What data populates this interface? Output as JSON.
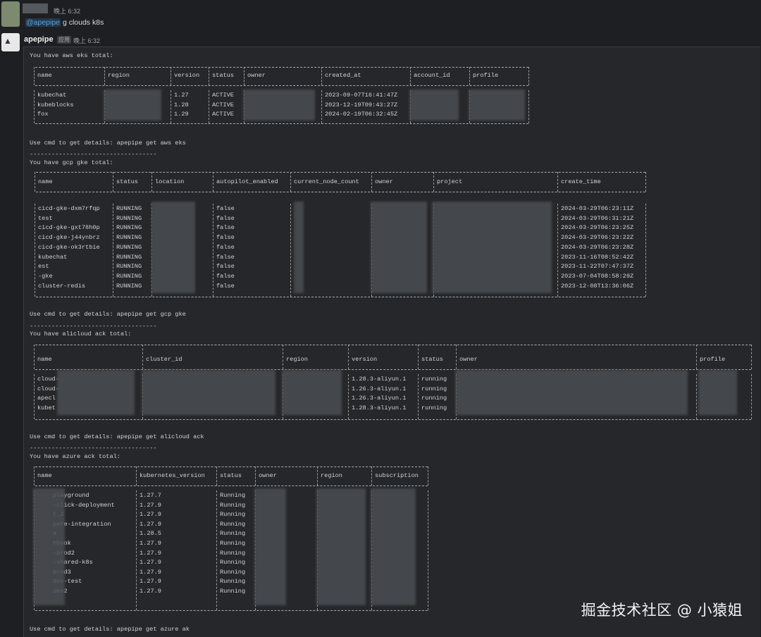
{
  "message1": {
    "time": "晚上 6:32",
    "mention": "@apepipe",
    "text": " g clouds k8s"
  },
  "message2": {
    "sender": "apepipe",
    "badge": "应用",
    "time": "晚上 6:32"
  },
  "eks": {
    "intro": "You have aws eks total:",
    "headers": [
      "name",
      "region",
      "version",
      "status",
      "owner",
      "created_at",
      "account_id",
      "profile"
    ],
    "rows": [
      [
        "kubechat",
        "",
        "1.27",
        "ACTIVE",
        "",
        "2023-09-07T16:41:47Z",
        "",
        ""
      ],
      [
        "kubeblocks",
        "",
        "1.28",
        "ACTIVE",
        "",
        "2023-12-19T09:43:27Z",
        "",
        ""
      ],
      [
        "fox",
        "",
        "1.29",
        "ACTIVE",
        "",
        "2024-02-19T06:32:45Z",
        "",
        ""
      ]
    ],
    "footer": "Use cmd to get details: apepipe get aws eks"
  },
  "gke": {
    "intro": "You have gcp gke total:",
    "headers": [
      "name",
      "status",
      "location",
      "autopilot_enabled",
      "current_node_count",
      "owner",
      "project",
      "create_time"
    ],
    "rows": [
      [
        "cicd-gke-dxm7rfqp",
        "RUNNING",
        "",
        "false",
        "",
        "",
        "",
        "2024-03-29T06:23:11Z"
      ],
      [
        "test",
        "RUNNING",
        "",
        "false",
        "",
        "",
        "",
        "2024-03-29T06:31:21Z"
      ],
      [
        "cicd-gke-gxt78h0p",
        "RUNNING",
        "",
        "false",
        "",
        "",
        "",
        "2024-03-29T06:23:25Z"
      ],
      [
        "cicd-gke-j44ynbrz",
        "RUNNING",
        "",
        "false",
        "",
        "",
        "",
        "2024-03-29T06:23:22Z"
      ],
      [
        "cicd-gke-ok3rtbie",
        "RUNNING",
        "",
        "false",
        "",
        "",
        "",
        "2024-03-29T06:23:28Z"
      ],
      [
        "kubechat",
        "RUNNING",
        "",
        "false",
        "",
        "",
        "",
        "2023-11-16T08:52:42Z"
      ],
      [
        "est",
        "RUNNING",
        "",
        "false",
        "",
        "",
        "",
        "2023-11-22T07:47:37Z"
      ],
      [
        "-gke",
        "RUNNING",
        "",
        "false",
        "",
        "",
        "",
        "2023-07-04T08:58:29Z"
      ],
      [
        "cluster-redis",
        "RUNNING",
        "",
        "false",
        "",
        "",
        "",
        "2023-12-08T13:36:06Z"
      ]
    ],
    "footer": "Use cmd to get details: apepipe get gcp gke"
  },
  "ack": {
    "intro": "You have alicloud ack total:",
    "headers": [
      "name",
      "cluster_id",
      "region",
      "version",
      "status",
      "owner",
      "profile"
    ],
    "rows": [
      [
        "cloud-",
        "",
        "",
        "1.28.3-aliyun.1",
        "running",
        "",
        ""
      ],
      [
        "cloud-",
        "",
        "",
        "1.26.3-aliyun.1",
        "running",
        "",
        ""
      ],
      [
        "apecl",
        "",
        "",
        "1.26.3-aliyun.1",
        "running",
        "",
        ""
      ],
      [
        "kubet",
        "",
        "",
        "1.28.3-aliyun.1",
        "running",
        "",
        ""
      ]
    ],
    "footer": "Use cmd to get details: apepipe get alicloud ack"
  },
  "aks": {
    "intro": "You have azure ack total:",
    "headers": [
      "name",
      "kubernetes_version",
      "status",
      "owner",
      "region",
      "subscription"
    ],
    "rows": [
      [
        "playground",
        "1.27.7",
        "Running",
        "",
        "",
        ""
      ],
      [
        "-click-deployment",
        "1.27.9",
        "Running",
        "",
        "",
        ""
      ],
      [
        "t_2",
        "1.27.9",
        "Running",
        "",
        "",
        ""
      ],
      [
        "pere-integration",
        "1.27.9",
        "Running",
        "",
        "",
        ""
      ],
      [
        "a",
        "1.28.5",
        "Running",
        "",
        "",
        ""
      ],
      [
        "hbook",
        "1.27.9",
        "Running",
        "",
        "",
        ""
      ],
      [
        "-prod2",
        "1.27.9",
        "Running",
        "",
        "",
        ""
      ],
      [
        "-shared-k8s",
        "1.27.9",
        "Running",
        "",
        "",
        ""
      ],
      [
        "prod3",
        "1.27.9",
        "Running",
        "",
        "",
        ""
      ],
      [
        "dev-test",
        "1.27.9",
        "Running",
        "",
        "",
        ""
      ],
      [
        "dev2",
        "1.27.9",
        "Running",
        "",
        "",
        ""
      ]
    ],
    "footer": "Use cmd to get details: apepipe get azure ak"
  },
  "dashes": "-----------------------------------",
  "watermark": "掘金技术社区 @ 小猿姐"
}
